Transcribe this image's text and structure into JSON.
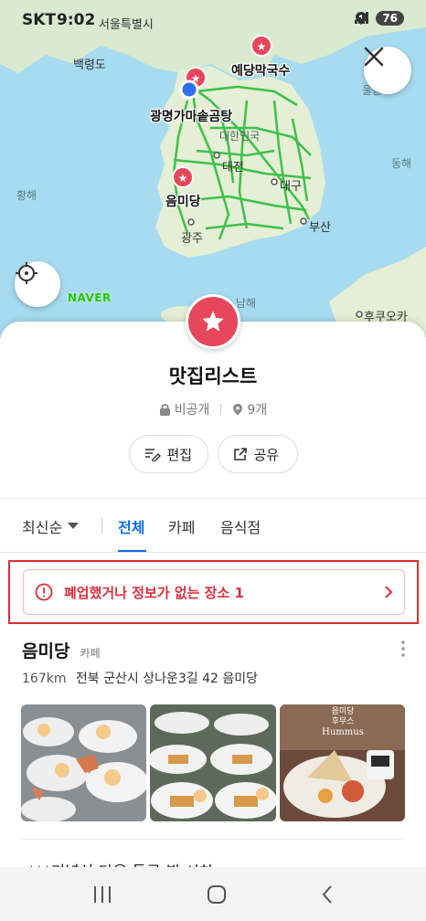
{
  "status_bar": {
    "carrier": "SKT",
    "time": "9:02",
    "network": "5G",
    "battery": "76"
  },
  "map": {
    "provider_logo": "NAVER",
    "labels": {
      "baengnyeongdo": "백령도",
      "yedang": "예당막국수",
      "gwangmyeong": "광명가마솥곰탕",
      "korea": "대한민국",
      "daejeon": "대전",
      "eummidang": "음미당",
      "daegu": "대구",
      "busan": "부산",
      "gwangju": "광주",
      "hwanghae": "황해",
      "donghae": "동해",
      "ulleung": "울릉",
      "namhae": "남해",
      "fukuoka": "후쿠오카",
      "seoul": "서울특별시"
    },
    "close_icon": "close-icon",
    "locate_icon": "crosshair-icon"
  },
  "list": {
    "title": "맛집리스트",
    "visibility": "비공개",
    "count": "9개",
    "edit_label": "편집",
    "share_label": "공유",
    "accent_color": "#e6475c"
  },
  "filters": {
    "sort_label": "최신순",
    "tabs": [
      "전체",
      "카페",
      "음식점"
    ],
    "active_tab": "전체"
  },
  "alert": {
    "text": "폐업했거나 정보가 없는 장소 1",
    "color": "#d8303e"
  },
  "place": {
    "name": "음미당",
    "category": "카페",
    "distance": "167km",
    "address": "전북 군산시 상나운3길 42 음미당",
    "photo_caption": "음미당\n후무스\nHummus"
  },
  "next_place_peek": "***기념식 다음 통근 뷔 시차"
}
